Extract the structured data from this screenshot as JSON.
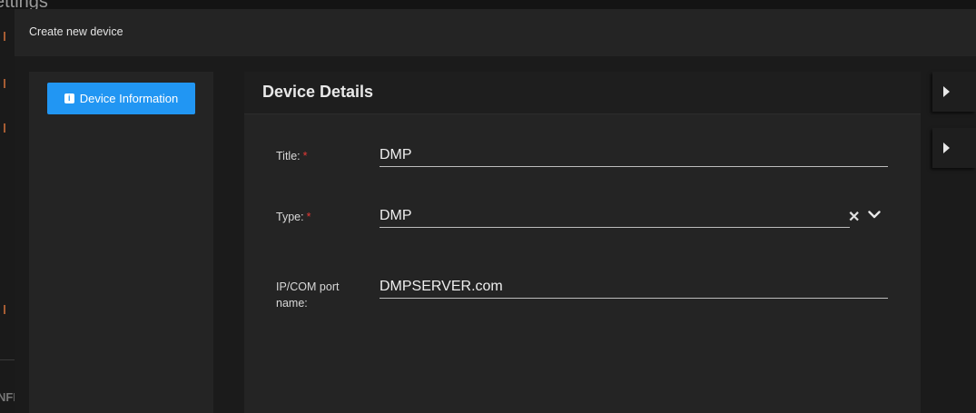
{
  "background_page": {
    "title": "ettings",
    "sidebar_fragment": "NFI"
  },
  "modal": {
    "title": "Create new device",
    "nav": {
      "items": [
        {
          "label": "Device Information",
          "icon": "info-icon",
          "active": true
        }
      ]
    },
    "details": {
      "title": "Device Details",
      "fields": {
        "title": {
          "label": "Title:",
          "required_mark": "*",
          "value": "DMP"
        },
        "type": {
          "label": "Type:",
          "required_mark": "*",
          "value": "DMP",
          "clear_glyph": "✕"
        },
        "ip_com": {
          "label": "IP/COM port name:",
          "value": "DMPSERVER.com"
        }
      }
    }
  },
  "colors": {
    "accent": "#2196f3",
    "required": "#e53935",
    "modal_bg": "#1b1b1b",
    "panel_bg": "#242424"
  }
}
